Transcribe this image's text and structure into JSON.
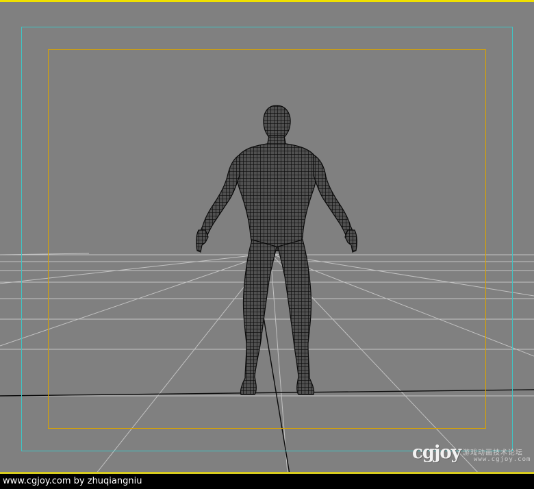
{
  "viewport": {
    "background_color": "#808080",
    "active_border_color": "#f0e000",
    "safe_frame_outer_color": "#3fc6c6",
    "safe_frame_inner_color": "#d9a400",
    "grid_color": "#c8c8c8",
    "ground_line_color": "#000000",
    "figure_mesh": "character-wireframe"
  },
  "watermark": {
    "logo": "cgjoy",
    "subtitle_cn": "游戏动画技术论坛",
    "url": "www.cgjoy.com"
  },
  "footer": {
    "credit": "www.cgjoy.com by zhuqiangniu"
  }
}
